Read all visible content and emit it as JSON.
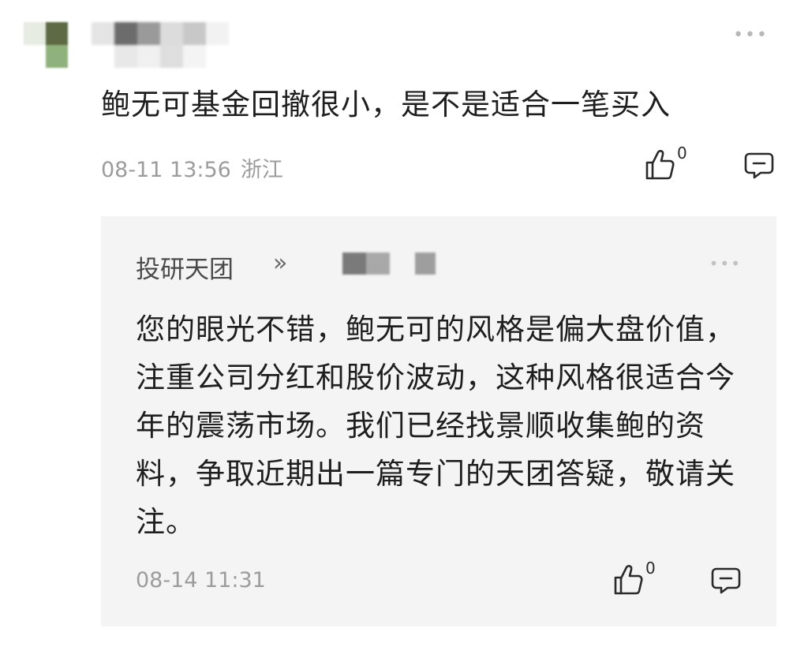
{
  "comment": {
    "text": "鲍无可基金回撤很小，是不是适合一笔买入",
    "time": "08-11 13:56",
    "location": "浙江",
    "like_count": "0"
  },
  "reply": {
    "author": "投研天团",
    "arrow": "»",
    "text": "您的眼光不错，鲍无可的风格是偏大盘价值，注重公司分红和股价波动，这种风格很适合今年的震荡市场。我们已经找景顺收集鲍的资料，争取近期出一篇专门的天团答疑，敬请关注。",
    "time": "08-14 11:31",
    "like_count": "0"
  },
  "icons": {
    "more": "more-dots-icon",
    "like": "thumbs-up-icon",
    "reply": "comment-bubble-icon"
  },
  "colors": {
    "text_primary": "#1e1e1e",
    "text_secondary": "#9c9c9c",
    "reply_background": "#f4f4f4"
  }
}
